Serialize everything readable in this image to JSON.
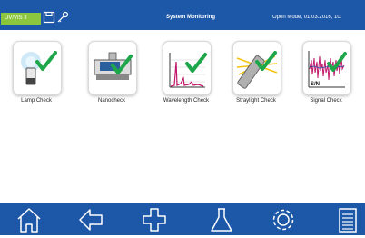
{
  "header": {
    "badge": "UV/VIS II",
    "title": "System Monitoring",
    "status": "Open Mode, 01.03.2016, 10:"
  },
  "tiles": [
    {
      "label": "Lamp Check"
    },
    {
      "label": "Nanocheck"
    },
    {
      "label": "Wavelength Check"
    },
    {
      "label": "Straylight Check"
    },
    {
      "label": "Signal Check",
      "overlay": "S/N"
    }
  ],
  "nav": [
    "home-icon",
    "back-arrow-icon",
    "add-cross-icon",
    "flask-icon",
    "settings-gear-icon",
    "document-list-icon"
  ],
  "colors": {
    "brand": "#1d57a8",
    "check": "#1ea64a",
    "badge": "#8cc63f"
  }
}
